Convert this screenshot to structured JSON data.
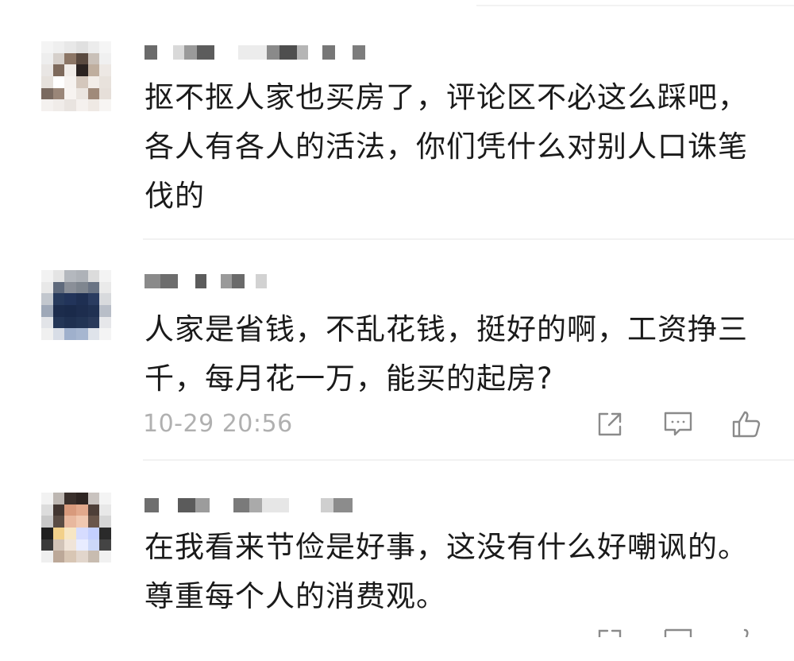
{
  "comments": [
    {
      "text": "抠不抠人家也买房了，评论区不必这么踩吧，\n各人有各人的活法，你们凭什么对别人口诛笔\n伐的"
    },
    {
      "text": "人家是省钱，不乱花钱，挺好的啊，工资挣三\n千，每月花一万，能买的起房?",
      "time": "10-29 20:56"
    },
    {
      "text": "在我看来节俭是好事，这没有什么好嘲讽的。\n尊重每个人的消费观。"
    }
  ],
  "icons": {
    "share": "share-icon",
    "reply": "reply-icon",
    "like": "like-icon"
  },
  "colors": {
    "text": "#1a1a1a",
    "timestamp": "#b0b0b0",
    "icon": "#8a8a8a",
    "divider": "#f2f2f2"
  }
}
